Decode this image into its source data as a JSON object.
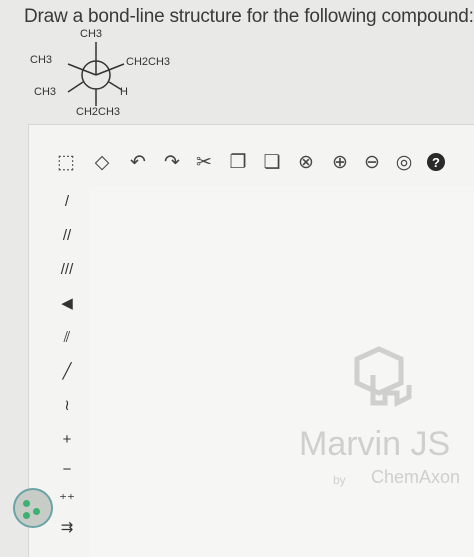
{
  "question": {
    "text": "Draw a bond-line structure for the following compound:"
  },
  "structure": {
    "labels": {
      "top": "CH3",
      "top_left": "CH3",
      "top_right": "CH2CH3",
      "bottom_left": "CH3",
      "bottom_right": "H",
      "bottom": "CH2CH3"
    }
  },
  "toolbar_top": [
    {
      "name": "select-tool-icon",
      "glyph": "⬚"
    },
    {
      "name": "erase-tool-icon",
      "glyph": "◇"
    },
    {
      "name": "undo-icon",
      "glyph": "↶"
    },
    {
      "name": "redo-icon",
      "glyph": "↷"
    },
    {
      "name": "cut-icon",
      "glyph": "✂"
    },
    {
      "name": "copy-icon",
      "glyph": "❐"
    },
    {
      "name": "paste-icon",
      "glyph": "❏"
    },
    {
      "name": "zoom-reset-icon",
      "glyph": "⊗"
    },
    {
      "name": "zoom-in-icon",
      "glyph": "⊕"
    },
    {
      "name": "zoom-out-icon",
      "glyph": "⊖"
    },
    {
      "name": "zoom-fit-icon",
      "glyph": "◎"
    },
    {
      "name": "help-icon",
      "glyph": "?"
    }
  ],
  "toolbar_left": [
    {
      "name": "single-bond-icon",
      "glyph": "/"
    },
    {
      "name": "double-bond-icon",
      "glyph": "//"
    },
    {
      "name": "triple-bond-icon",
      "glyph": "///"
    },
    {
      "name": "wedge-bond-icon",
      "glyph": "◀"
    },
    {
      "name": "hash-bond-icon",
      "glyph": "⫽"
    },
    {
      "name": "chain-icon",
      "glyph": "╱"
    },
    {
      "name": "zigzag-icon",
      "glyph": "≀"
    },
    {
      "name": "charge-plus-icon",
      "glyph": "+"
    },
    {
      "name": "charge-minus-icon",
      "glyph": "−"
    },
    {
      "name": "electron-pair-icon",
      "glyph": "⁺⁺"
    },
    {
      "name": "electron-arrow-icon",
      "glyph": "⇉"
    }
  ],
  "watermark": {
    "title": "Marvin JS",
    "by": "by",
    "brand": "ChemAxon"
  }
}
